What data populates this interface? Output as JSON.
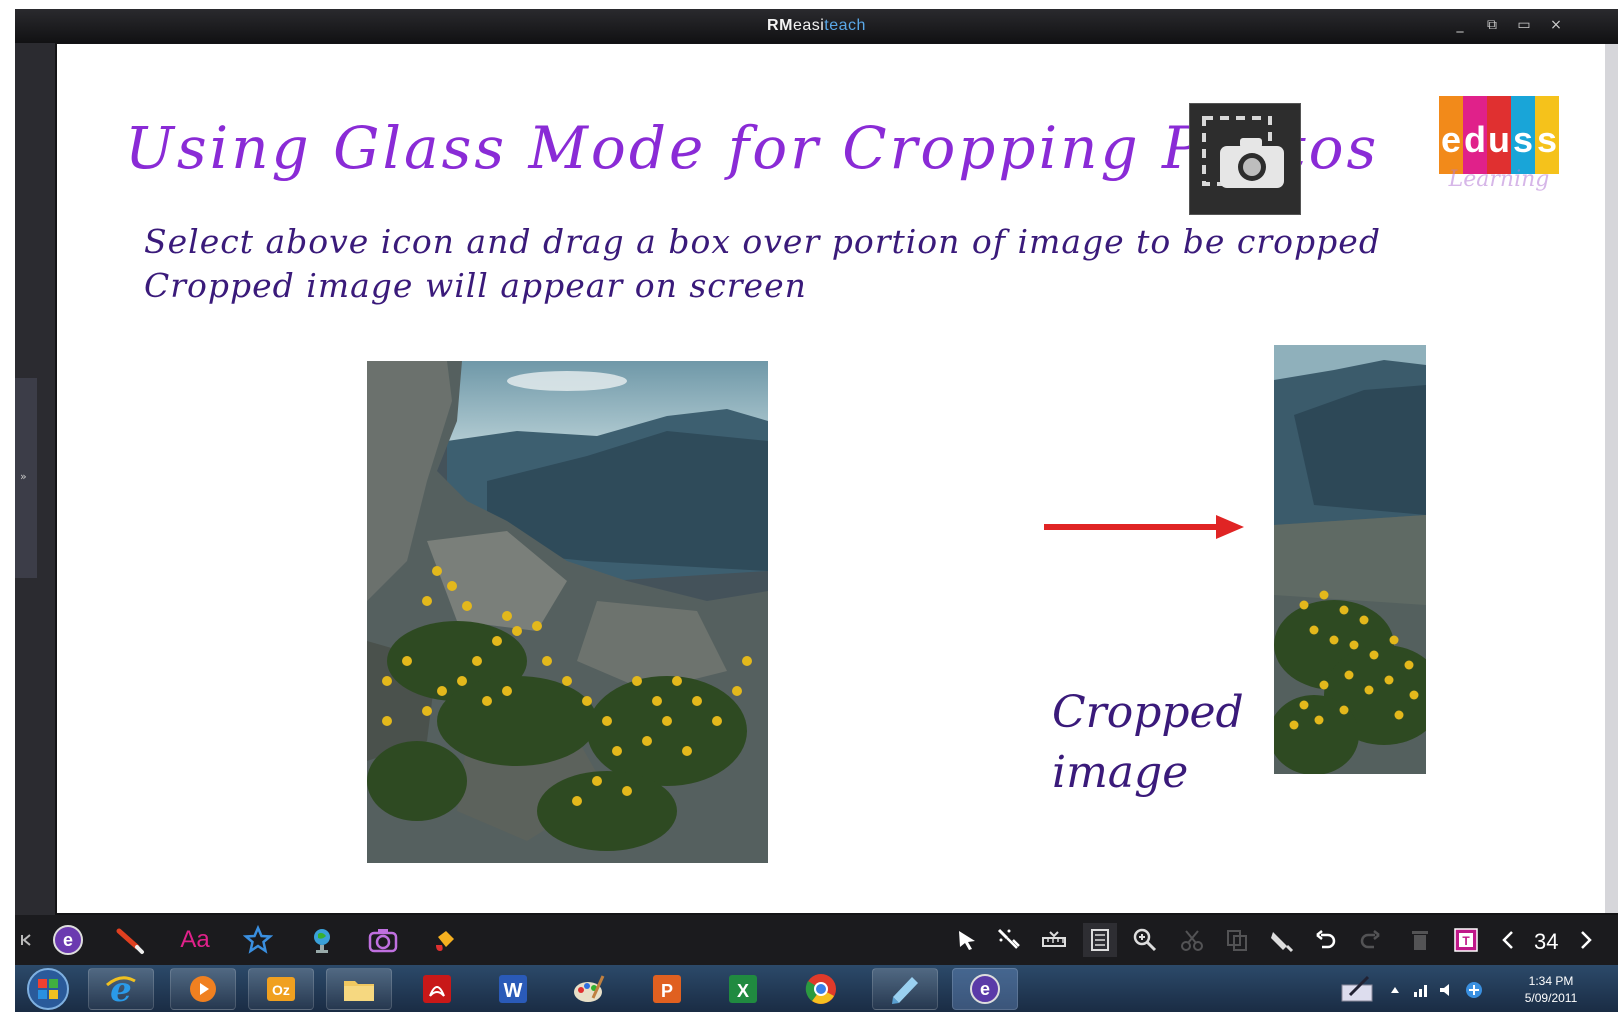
{
  "window": {
    "title_part1": "RM",
    "title_part2": "easi",
    "title_part3": "teach",
    "controls": [
      "_",
      "⧉",
      "▭",
      "×"
    ]
  },
  "slide": {
    "heading": "Using Glass Mode for Cropping Photos",
    "camera_tool_icon": "camera-crop-icon",
    "instructions": [
      "Select above icon and drag a box over portion of image to be cropped",
      "Cropped image will appear on screen"
    ],
    "cropped_label_line1": "Cropped",
    "cropped_label_line2": "image",
    "logo": {
      "letters": [
        "e",
        "d",
        "u",
        "s",
        "s"
      ],
      "subtitle": "Learning",
      "colors": [
        "#f28a1a",
        "#e0218a",
        "#e03030",
        "#19a5d8",
        "#f5c21b"
      ]
    },
    "arrow_color": "#e02424"
  },
  "toolbar": {
    "left_tools": [
      "collapse-icon",
      "easiteach-icon",
      "pen-icon",
      "text-icon",
      "star-shape-icon",
      "globe-icon",
      "camera-icon",
      "fill-icon"
    ],
    "text_tool_label": "Aa",
    "right_tools": [
      "select-icon",
      "magic-pen-icon",
      "ruler-icon",
      "glass-icon",
      "zoom-icon",
      "cut-icon",
      "copy-icon",
      "paste-icon",
      "undo-icon",
      "redo-icon",
      "delete-icon",
      "textbox-icon",
      "prev-page-icon",
      "next-page-icon"
    ],
    "page_number": "34"
  },
  "taskbar": {
    "apps": [
      "start-orb",
      "internet-explorer",
      "media-player",
      "outlook",
      "file-explorer",
      "acrobat",
      "word",
      "paint",
      "powerpoint",
      "excel",
      "chrome",
      "onenote",
      "easiteach"
    ],
    "time": "1:34 PM",
    "date": "5/09/2011"
  }
}
